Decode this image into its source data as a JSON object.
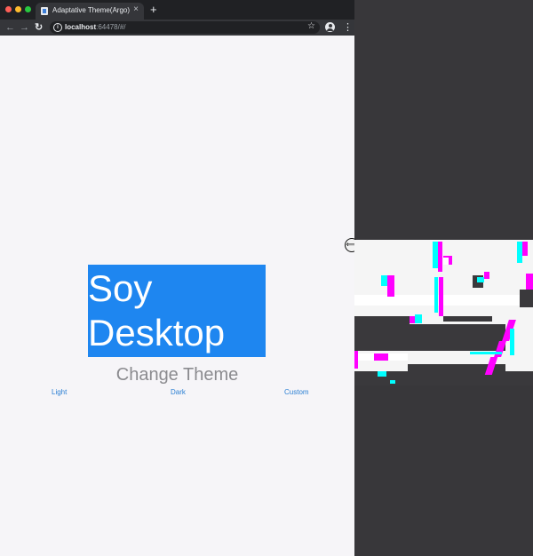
{
  "browser": {
    "tab_title": "Adaptative Theme(Argo)",
    "tab_close": "×",
    "new_tab": "+",
    "url_host": "localhost",
    "url_rest": ":64478/#/",
    "back_icon": "←",
    "forward_icon": "→",
    "reload_icon": "↻",
    "info_icon": "i",
    "star_icon": "☆",
    "menu_icon": "⋮"
  },
  "app": {
    "hero_text": "Soy Desktop",
    "change_theme_title": "Change Theme",
    "buttons": {
      "light": "Light",
      "dark": "Dark",
      "custom": "Custom"
    }
  },
  "resize_handle_icon": "⟺",
  "colors": {
    "accent": "#1e86f0",
    "link": "#2a7fd3",
    "page_background": "#f6f5f8",
    "desktop_background": "#38373a",
    "glitch_cyan": "#00ffff",
    "glitch_magenta": "#ff00ff"
  }
}
